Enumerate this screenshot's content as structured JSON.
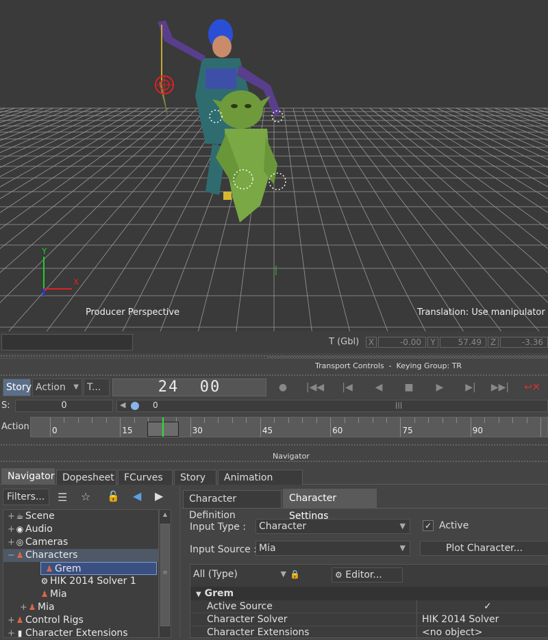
{
  "viewport": {
    "camera_label": "Producer Perspective",
    "mode_label": "Translation: Use manipulator",
    "axis_x": "X",
    "axis_y": "Y"
  },
  "statusbar": {
    "coord_label": "T (Gbl)",
    "x_label": "X",
    "x_value": "-0.00",
    "y_label": "Y",
    "y_value": "57.49",
    "z_label": "Z",
    "z_value": "-3.36"
  },
  "transport": {
    "header": "Transport Controls  -  Keying Group: TR",
    "story_btn": "Story",
    "action_btn": "Action",
    "t_btn": "T...",
    "frame_display": "24  00",
    "s_label": "S:",
    "s_value": "0",
    "slider_value": "0",
    "timeline_label": "Action",
    "ticks": [
      "0",
      "15",
      "30",
      "45",
      "60",
      "75",
      "90"
    ],
    "current_frame": 24
  },
  "navigator_header": "Navigator",
  "tabs": [
    {
      "label": "Navigator",
      "active": true
    },
    {
      "label": "Dopesheet",
      "active": false
    },
    {
      "label": "FCurves",
      "active": false
    },
    {
      "label": "Story",
      "active": false
    },
    {
      "label": "Animation Trigger",
      "active": false
    }
  ],
  "filters_btn": "Filters...",
  "tree": [
    {
      "label": "Scene",
      "icon": "scene-icon",
      "glyph": "☕",
      "indent": 0,
      "expander": "+"
    },
    {
      "label": "Audio",
      "icon": "audio-icon",
      "glyph": "◉",
      "indent": 0,
      "expander": "+"
    },
    {
      "label": "Cameras",
      "icon": "camera-icon",
      "glyph": "◎",
      "indent": 0,
      "expander": "+"
    },
    {
      "label": "Characters",
      "icon": "character-icon",
      "glyph": "♟",
      "indent": 0,
      "expander": "−",
      "highlight": true
    },
    {
      "label": "Grem",
      "icon": "character-icon",
      "glyph": "♟",
      "indent": 1,
      "expander": "−",
      "selected": true
    },
    {
      "label": "HIK 2014 Solver 1",
      "icon": "gear-icon",
      "glyph": "⚙",
      "indent": 2,
      "expander": ""
    },
    {
      "label": "Mia",
      "icon": "character-icon",
      "glyph": "♟",
      "indent": 2,
      "expander": ""
    },
    {
      "label": "Mia",
      "icon": "character-icon",
      "glyph": "♟",
      "indent": 1,
      "expander": "+"
    },
    {
      "label": "Control Rigs",
      "icon": "rig-icon",
      "glyph": "♟",
      "indent": 0,
      "expander": "+"
    },
    {
      "label": "Character Extensions",
      "icon": "extension-icon",
      "glyph": "▮",
      "indent": 0,
      "expander": "+"
    }
  ],
  "settings": {
    "tab_definition": "Character Definition",
    "tab_settings": "Character Settings",
    "input_type_label": "Input Type :",
    "input_type_value": "Character",
    "active_label": "Active",
    "active_checked": true,
    "input_source_label": "Input Source :",
    "input_source_value": "Mia",
    "plot_btn": "Plot Character...",
    "filter_value": "All (Type)",
    "editor_btn": "Editor...",
    "group_title": "Grem",
    "props": [
      {
        "name": "Active Source",
        "value": "✓"
      },
      {
        "name": "Character Solver",
        "value": "HIK 2014 Solver"
      },
      {
        "name": "Character Extensions",
        "value": "<no object>"
      }
    ]
  }
}
